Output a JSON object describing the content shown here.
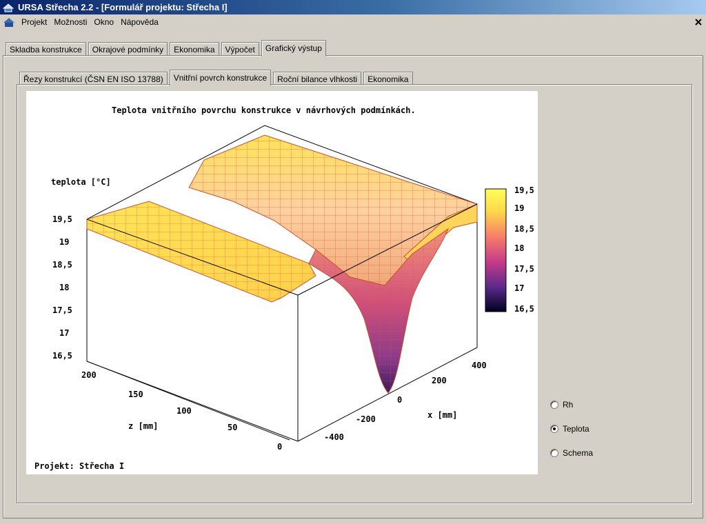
{
  "window": {
    "title": "URSA Střecha 2.2 - [Formulář projektu: Střecha I]"
  },
  "menu": [
    "Projekt",
    "Možnosti",
    "Okno",
    "Nápověda"
  ],
  "main_tabs": [
    {
      "label": "Skladba konstrukce",
      "active": false
    },
    {
      "label": "Okrajové podmínky",
      "active": false
    },
    {
      "label": "Ekonomika",
      "active": false
    },
    {
      "label": "Výpočet",
      "active": false
    },
    {
      "label": "Grafický výstup",
      "active": true
    }
  ],
  "sub_tabs": [
    {
      "label": "Řezy konstrukcí (ČSN EN ISO 13788)",
      "active": false
    },
    {
      "label": "Vnitřní povrch konstrukce",
      "active": true
    },
    {
      "label": "Roční bilance vlhkosti",
      "active": false
    },
    {
      "label": "Ekonomika",
      "active": false
    }
  ],
  "plot": {
    "title": "Teplota  vnitřního povrchu konstrukce v návrhových podmínkách.",
    "zaxis_label": "teplota [°C]",
    "z_ticks": [
      "19,5",
      "19",
      "18,5",
      "18",
      "17,5",
      "17",
      "16,5"
    ],
    "y_label": "z [mm]",
    "y_ticks": [
      "200",
      "150",
      "100",
      "50",
      "0"
    ],
    "x_label": "x [mm]",
    "x_ticks": [
      "400",
      "200",
      "0",
      "-200",
      "-400"
    ],
    "colorbar_ticks": [
      "19,5",
      "19",
      "18,5",
      "18",
      "17,5",
      "17",
      "16,5"
    ],
    "footer": "Projekt: Střecha I"
  },
  "chart_data": {
    "type": "surface",
    "title": "Teplota  vnitřního povrchu konstrukce v návrhových podmínkách.",
    "x_label": "x [mm]",
    "y_label": "z [mm]",
    "z_label": "teplota [°C]",
    "x_range": [
      -400,
      400
    ],
    "y_range": [
      0,
      200
    ],
    "z_range": [
      16.5,
      19.5
    ],
    "x": [
      -400,
      -200,
      0,
      200,
      400
    ],
    "y": [
      0,
      50,
      100,
      150,
      200
    ],
    "note_values": "Surface temperature approx. 19.4 °C away from the junction, dropping to a minimum of about 16.5 °C at x = 0, z = 0"
  },
  "radio_options": [
    {
      "label": "Rh",
      "checked": false
    },
    {
      "label": "Teplota",
      "checked": true
    },
    {
      "label": "Schema",
      "checked": false
    }
  ]
}
